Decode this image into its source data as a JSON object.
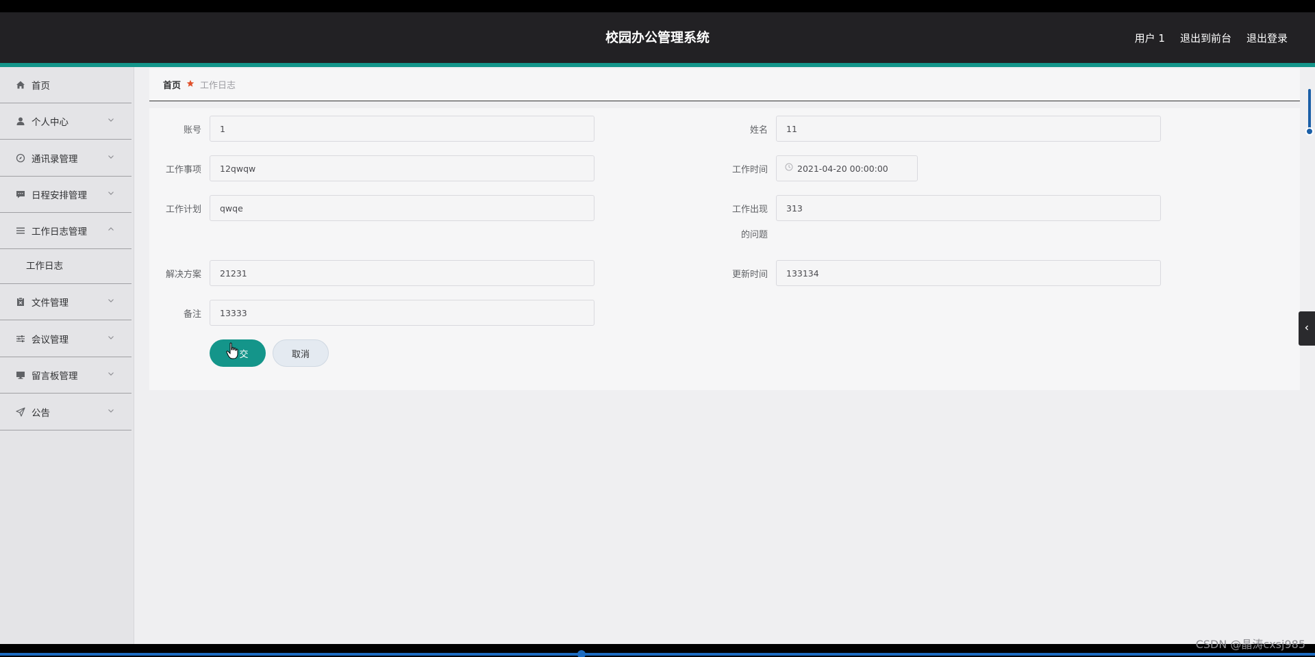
{
  "header": {
    "title": "校园办公管理系统",
    "user": "用户 1",
    "back_to_front": "退出到前台",
    "logout": "退出登录"
  },
  "sidebar": {
    "items": [
      {
        "label": "首页",
        "icon": "home-icon"
      },
      {
        "label": "个人中心",
        "icon": "user-icon"
      },
      {
        "label": "通讯录管理",
        "icon": "compass-icon"
      },
      {
        "label": "日程安排管理",
        "icon": "chat-icon"
      },
      {
        "label": "工作日志管理",
        "icon": "list-icon",
        "expanded": true
      },
      {
        "label": "文件管理",
        "icon": "file-x-icon"
      },
      {
        "label": "会议管理",
        "icon": "sliders-icon"
      },
      {
        "label": "留言板管理",
        "icon": "monitor-icon"
      },
      {
        "label": "公告",
        "icon": "send-icon"
      }
    ],
    "submenu": {
      "label": "工作日志"
    }
  },
  "breadcrumb": {
    "home": "首页",
    "current": "工作日志"
  },
  "form": {
    "account": {
      "label": "账号",
      "value": "1"
    },
    "name": {
      "label": "姓名",
      "value": "11"
    },
    "work_item": {
      "label": "工作事项",
      "value": "12qwqw"
    },
    "work_time": {
      "label": "工作时间",
      "value": "2021-04-20 00:00:00"
    },
    "work_plan": {
      "label": "工作计划",
      "value": "qwqe"
    },
    "work_issue": {
      "label_line1": "工作出现",
      "label_line2": "的问题",
      "value": "313"
    },
    "solution": {
      "label": "解决方案",
      "value": "21231"
    },
    "update_time": {
      "label": "更新时间",
      "value": "133134"
    },
    "remark": {
      "label": "备注",
      "value": "13333"
    },
    "submit_label": "交",
    "cancel_label": "取消"
  },
  "watermark": "CSDN @晶涛cxsj985",
  "colors": {
    "header_bg": "#222124",
    "accent": "#14958a",
    "sidebar_bg": "#e4e4e7",
    "panel_bg": "#f6f6f7"
  }
}
